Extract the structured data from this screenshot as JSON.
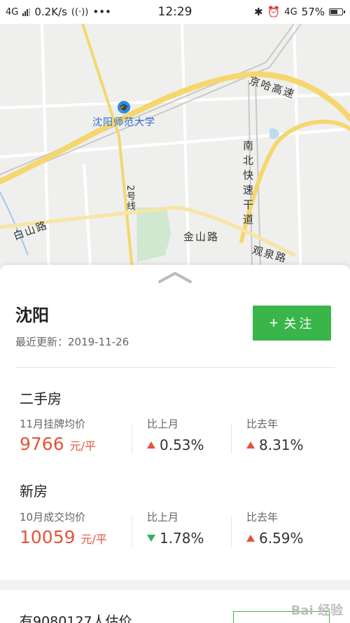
{
  "status_bar": {
    "network": "4G",
    "speed": "0.2K/s",
    "more": "•••",
    "time": "12:29",
    "net_right": "4G",
    "battery": "57%"
  },
  "map": {
    "poi": "沈阳师范大学",
    "road_jingha": "京哈高速",
    "road_nanbei": "南北快速干道",
    "road_baishan": "白山路",
    "road_jinshan": "金山路",
    "road_guanquan": "观泉路",
    "metro_line": "2号线"
  },
  "header": {
    "city": "沈阳",
    "updated": "最近更新：2019-11-26",
    "follow_label": "关注",
    "follow_icon": "plus-icon"
  },
  "second_hand": {
    "title": "二手房",
    "price_label": "11月挂牌均价",
    "price": "9766",
    "unit": "元/平",
    "mom_label": "比上月",
    "mom_value": "0.53%",
    "mom_dir": "up",
    "yoy_label": "比去年",
    "yoy_value": "8.31%",
    "yoy_dir": "up"
  },
  "new_home": {
    "title": "新房",
    "price_label": "10月成交均价",
    "price": "10059",
    "unit": "元/平",
    "mom_label": "比上月",
    "mom_value": "1.78%",
    "mom_dir": "down",
    "yoy_label": "比去年",
    "yoy_value": "6.59%",
    "yoy_dir": "up"
  },
  "bottom": {
    "text": "有9080127人估价"
  },
  "watermark": "Bai 经验",
  "colors": {
    "accent_green": "#3ab54a",
    "price_red": "#e4543b",
    "down_green": "#2fb45a"
  }
}
